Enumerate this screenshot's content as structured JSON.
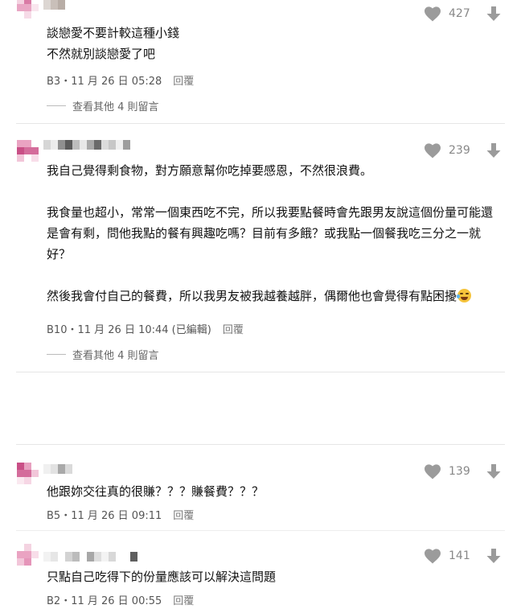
{
  "icons": {
    "heart": "heart-icon",
    "downvote": "down-arrow-icon",
    "emoji": "rolling-laughing-emoji-icon"
  },
  "colors": {
    "icon_gray": "#9b9b9b",
    "meta_text": "#555555",
    "avatar_pink": "#c94f86",
    "avatar_light_pink": "#f2c6d9"
  },
  "comments": [
    {
      "floor_meta": "B3・11 月 26 日 05:28",
      "reply_label": "回覆",
      "likes": "427",
      "lines": [
        "談戀愛不要計較這種小錢",
        "不然就別談戀愛了吧"
      ],
      "more_replies": "查看其他 4 則留言"
    },
    {
      "floor_meta": "B10・11 月 26 日 10:44 (已編輯)",
      "reply_label": "回覆",
      "likes": "239",
      "paragraphs": [
        "我自己覺得剩食物，對方願意幫你吃掉要感恩，不然很浪費。",
        "我食量也超小，常常一個東西吃不完，所以我要點餐時會先跟男友說這個份量可能還是會有剩，問他我點的餐有興趣吃嗎？目前有多餓？或我點一個餐我吃三分之一就好？",
        "然後我會付自己的餐費，所以我男友被我越養越胖，偶爾他也會覺得有點困擾"
      ],
      "more_replies": "查看其他 4 則留言"
    },
    {
      "floor_meta": "B5・11 月 26 日 09:11",
      "reply_label": "回覆",
      "likes": "139",
      "lines": [
        "他跟妳交往真的很賺？？？賺餐費？？？"
      ]
    },
    {
      "floor_meta": "B2・11 月 26 日 00:55",
      "reply_label": "回覆",
      "likes": "141",
      "lines": [
        "只點自己吃得下的份量應該可以解決這問題"
      ]
    }
  ]
}
